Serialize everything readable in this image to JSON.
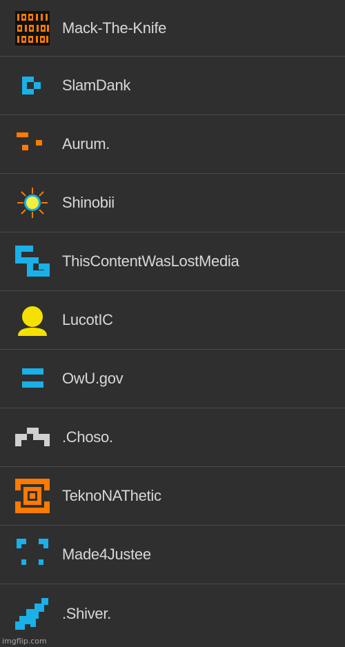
{
  "users": [
    {
      "name": "Mack-The-Knife",
      "icon": "binary-digits-icon",
      "color": "#ff7a00"
    },
    {
      "name": "SlamDank",
      "icon": "cyan-block-icon",
      "color": "#1ab0e8"
    },
    {
      "name": "Aurum.",
      "icon": "orange-dash-icon",
      "color": "#ff7a00"
    },
    {
      "name": "Shinobii",
      "icon": "sun-icon",
      "color": "#f5e100"
    },
    {
      "name": "ThisContentWasLostMedia",
      "icon": "cyan-s-shape-icon",
      "color": "#1ab0e8"
    },
    {
      "name": "LucotIC",
      "icon": "user-silhouette-icon",
      "color": "#f5e100"
    },
    {
      "name": "OwU.gov",
      "icon": "equals-bars-icon",
      "color": "#1ab0e8"
    },
    {
      "name": ".Choso.",
      "icon": "gray-steps-icon",
      "color": "#cfcfcf"
    },
    {
      "name": "TeknoNAThetic",
      "icon": "orange-target-icon",
      "color": "#ff7a00"
    },
    {
      "name": "Made4Justee",
      "icon": "cyan-brackets-icon",
      "color": "#1ab0e8"
    },
    {
      "name": ".Shiver.",
      "icon": "cyan-diagonal-icon",
      "color": "#1ab0e8"
    }
  ],
  "watermark": "imgflip.com"
}
